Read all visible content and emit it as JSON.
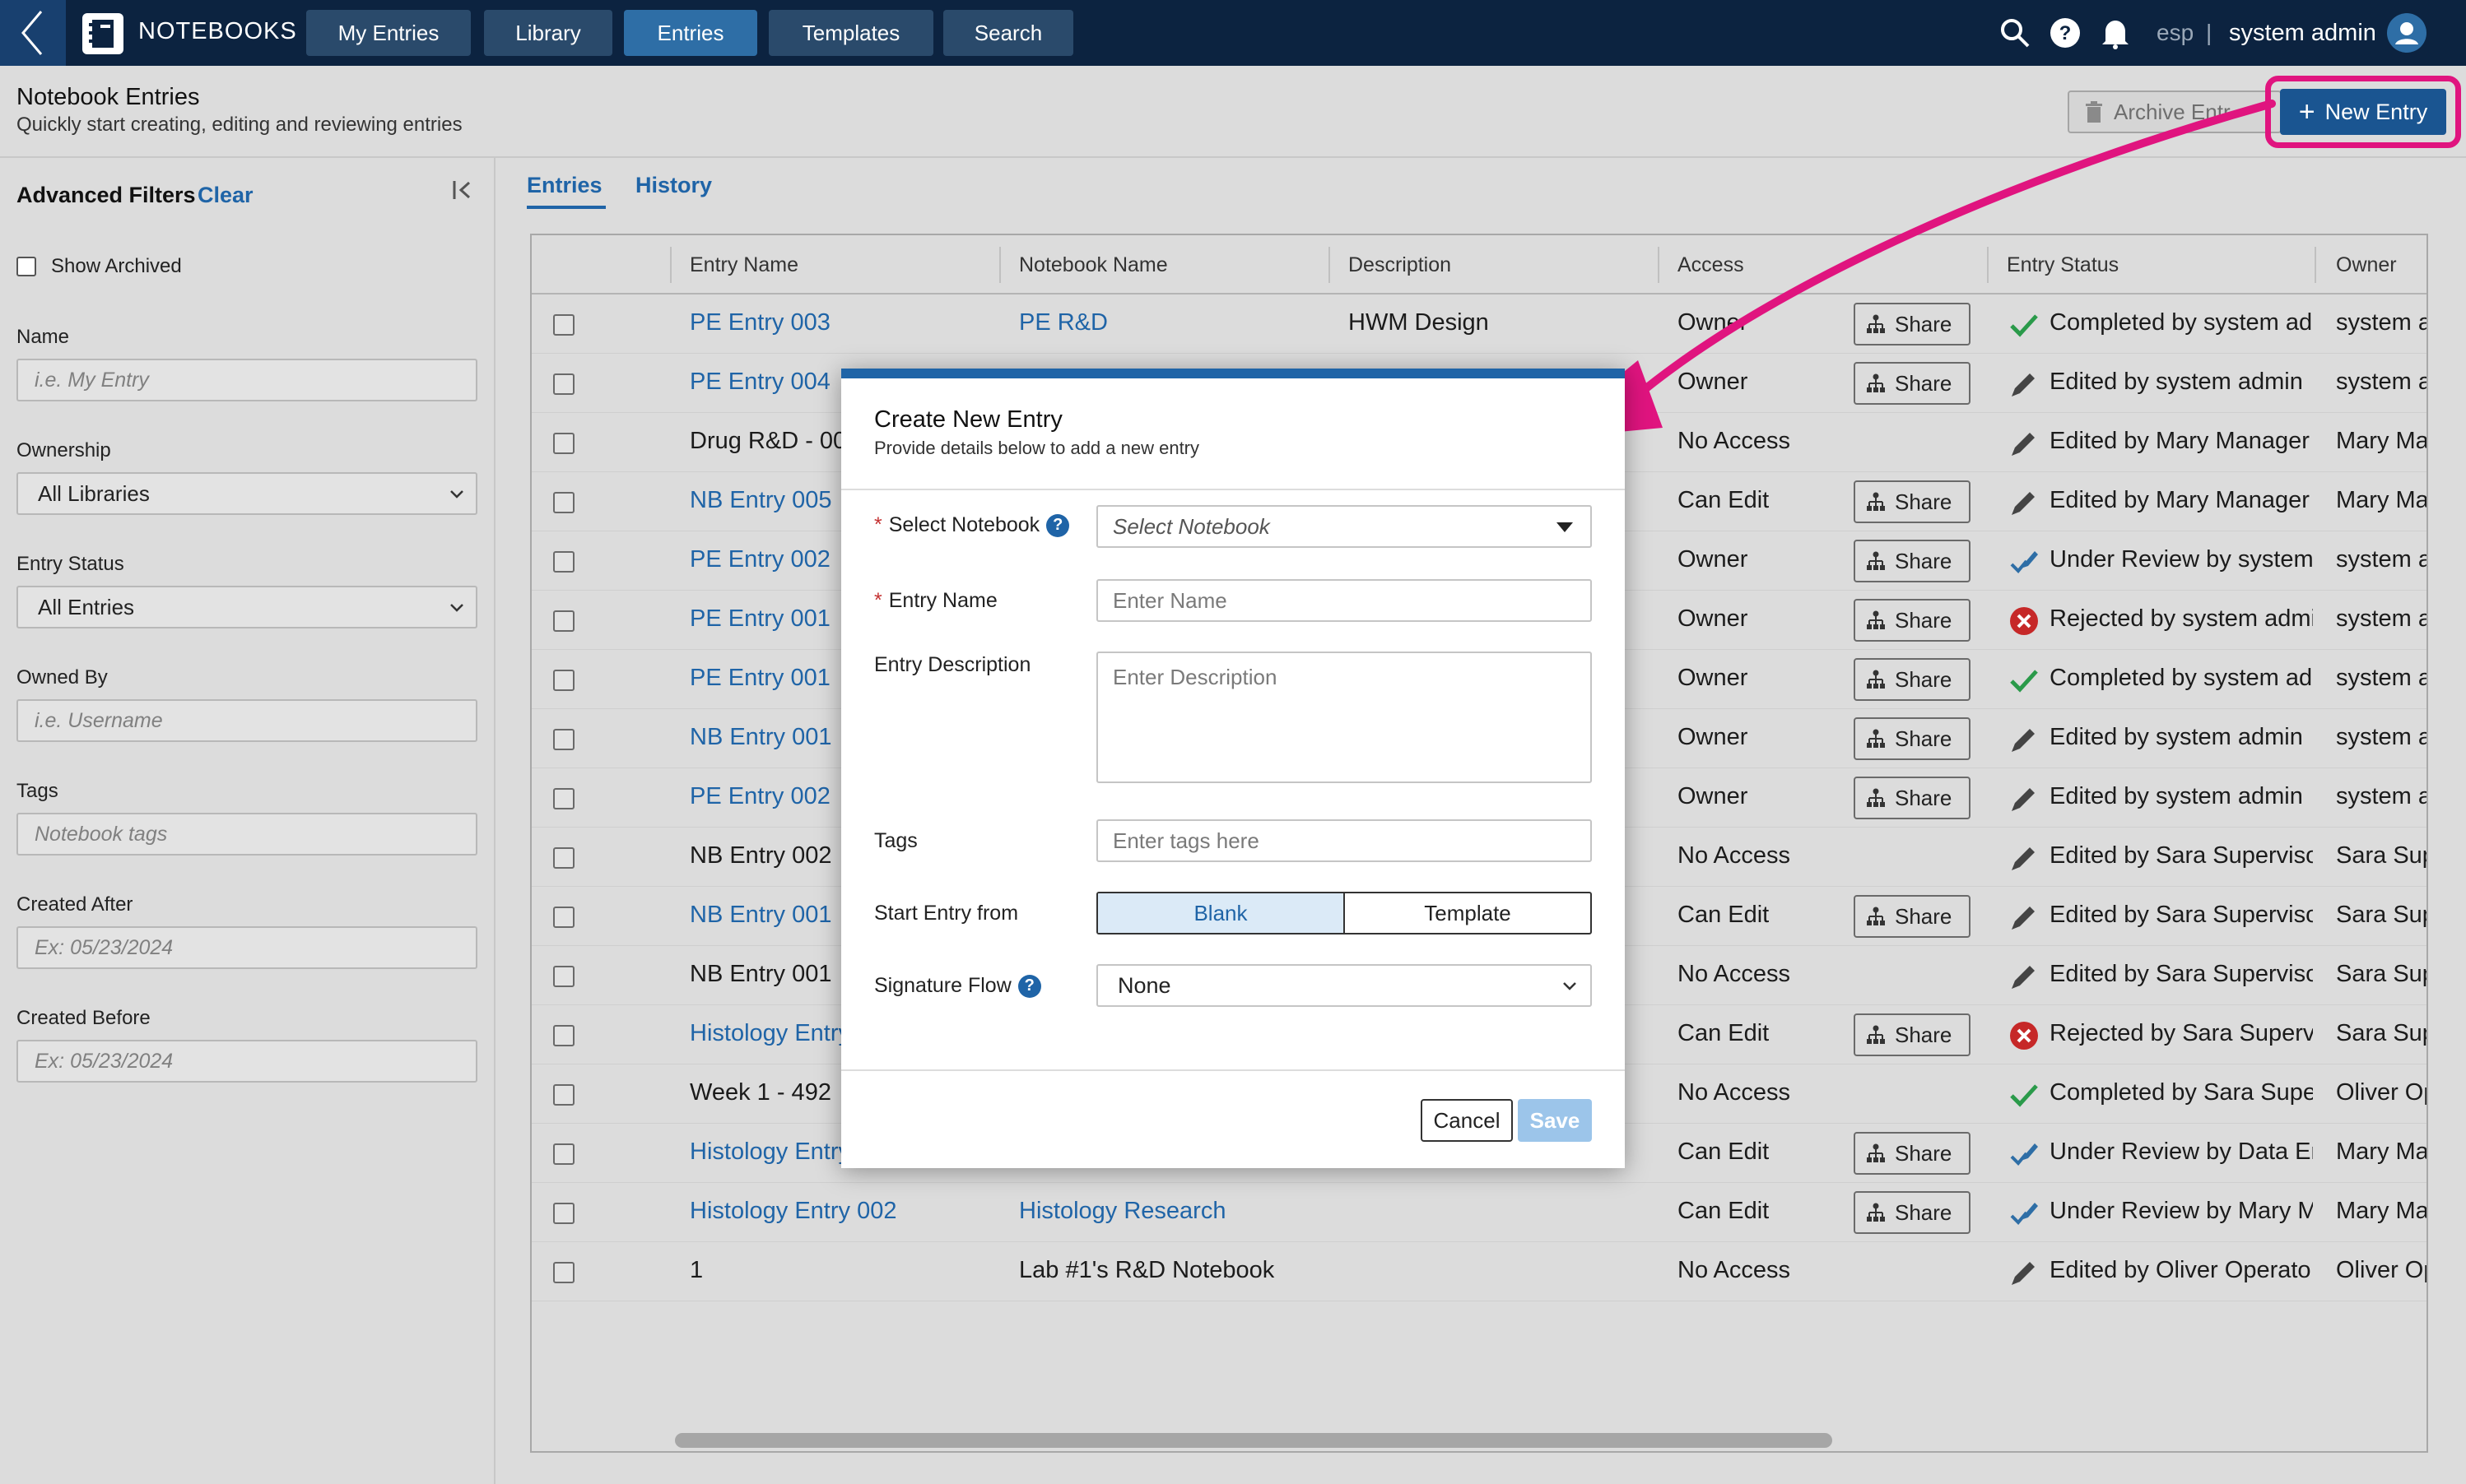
{
  "app": {
    "name": "NOTEBOOKS"
  },
  "nav": {
    "items": [
      {
        "label": "My Entries",
        "active": false
      },
      {
        "label": "Library",
        "active": false
      },
      {
        "label": "Entries",
        "active": true
      },
      {
        "label": "Templates",
        "active": false
      },
      {
        "label": "Search",
        "active": false
      }
    ]
  },
  "topbar": {
    "locale": "esp",
    "separator": "|",
    "user": "system admin"
  },
  "header": {
    "title": "Notebook Entries",
    "subtitle": "Quickly start creating, editing and reviewing entries",
    "archive_label": "Archive Entr",
    "new_entry_label": "New Entry",
    "new_entry_plus": "+"
  },
  "sidebar": {
    "title": "Advanced Filters",
    "clear_label": "Clear",
    "collapse_glyph": "|<",
    "show_archived_label": "Show Archived",
    "name_label": "Name",
    "name_placeholder": "i.e. My Entry",
    "ownership_label": "Ownership",
    "ownership_value": "All Libraries",
    "entry_status_label": "Entry Status",
    "entry_status_value": "All Entries",
    "owned_by_label": "Owned By",
    "owned_by_placeholder": "i.e. Username",
    "tags_label": "Tags",
    "tags_placeholder": "Notebook tags",
    "created_after_label": "Created After",
    "created_after_placeholder": "Ex: 05/23/2024",
    "created_before_label": "Created Before",
    "created_before_placeholder": "Ex: 05/23/2024"
  },
  "tabs": [
    {
      "label": "Entries",
      "active": true
    },
    {
      "label": "History",
      "active": false
    }
  ],
  "table": {
    "columns": [
      "Entry Name",
      "Notebook Name",
      "Description",
      "Access",
      "Entry Status",
      "Owner"
    ],
    "share_label": "Share",
    "rows": [
      {
        "name": "PE Entry 003",
        "name_link": true,
        "notebook": "PE R&D",
        "notebook_link": true,
        "description": "HWM Design",
        "access": "Owner",
        "share": true,
        "status_icon": "check",
        "status": "Completed by system ad",
        "owner": "system a"
      },
      {
        "name": "PE Entry 004",
        "name_link": true,
        "notebook": "",
        "notebook_link": false,
        "description": "",
        "access": "Owner",
        "share": true,
        "status_icon": "pencil",
        "status": "Edited by system admin",
        "owner": "system a"
      },
      {
        "name": "Drug R&D - 00",
        "name_link": false,
        "notebook": "",
        "notebook_link": false,
        "description": "",
        "access": "No Access",
        "share": false,
        "status_icon": "pencil",
        "status": "Edited by Mary Manager",
        "owner": "Mary Ma"
      },
      {
        "name": "NB Entry 005",
        "name_link": true,
        "notebook": "",
        "notebook_link": false,
        "description": "",
        "access": "Can Edit",
        "share": true,
        "status_icon": "pencil",
        "status": "Edited by Mary Manager",
        "owner": "Mary Ma"
      },
      {
        "name": "PE Entry 002",
        "name_link": true,
        "notebook": "",
        "notebook_link": false,
        "description": "",
        "access": "Owner",
        "share": true,
        "status_icon": "review",
        "status": "Under Review by system",
        "owner": "system a"
      },
      {
        "name": "PE Entry 001",
        "name_link": true,
        "notebook": "",
        "notebook_link": false,
        "description": "",
        "access": "Owner",
        "share": true,
        "status_icon": "rejected",
        "status": "Rejected by system admi",
        "owner": "system a"
      },
      {
        "name": "PE Entry 001",
        "name_link": true,
        "notebook": "",
        "notebook_link": false,
        "description": "",
        "access": "Owner",
        "share": true,
        "status_icon": "check",
        "status": "Completed by system ad",
        "owner": "system a"
      },
      {
        "name": "NB Entry 001",
        "name_link": true,
        "notebook": "",
        "notebook_link": false,
        "description": "",
        "access": "Owner",
        "share": true,
        "status_icon": "pencil",
        "status": "Edited by system admin",
        "owner": "system a"
      },
      {
        "name": "PE Entry 002",
        "name_link": true,
        "notebook": "",
        "notebook_link": false,
        "description": "",
        "access": "Owner",
        "share": true,
        "status_icon": "pencil",
        "status": "Edited by system admin",
        "owner": "system a"
      },
      {
        "name": "NB Entry 002",
        "name_link": false,
        "notebook": "",
        "notebook_link": false,
        "description": "",
        "access": "No Access",
        "share": false,
        "status_icon": "pencil",
        "status": "Edited by Sara Superviso",
        "owner": "Sara Sup"
      },
      {
        "name": "NB Entry 001",
        "name_link": true,
        "notebook": "",
        "notebook_link": false,
        "description": "",
        "access": "Can Edit",
        "share": true,
        "status_icon": "pencil",
        "status": "Edited by Sara Superviso",
        "owner": "Sara Sup"
      },
      {
        "name": "NB Entry 001",
        "name_link": false,
        "notebook": "",
        "notebook_link": false,
        "description": "",
        "access": "No Access",
        "share": false,
        "status_icon": "pencil",
        "status": "Edited by Sara Superviso",
        "owner": "Sara Sup"
      },
      {
        "name": "Histology Entry",
        "name_link": true,
        "notebook": "",
        "notebook_link": false,
        "description": "",
        "access": "Can Edit",
        "share": true,
        "status_icon": "rejected",
        "status": "Rejected by Sara Supervis",
        "owner": "Sara Sup"
      },
      {
        "name": "Week 1 - 492",
        "name_link": false,
        "notebook": "",
        "notebook_link": false,
        "description": "",
        "access": "No Access",
        "share": false,
        "status_icon": "check",
        "status": "Completed by Sara Super",
        "owner": "Oliver Op"
      },
      {
        "name": "Histology Entry",
        "name_link": true,
        "notebook": "",
        "notebook_link": false,
        "description": "",
        "access": "Can Edit",
        "share": true,
        "status_icon": "review",
        "status": "Under Review by Data En",
        "owner": "Mary Ma"
      },
      {
        "name": "Histology Entry 002",
        "name_link": true,
        "notebook": "Histology Research",
        "notebook_link": true,
        "description": "",
        "access": "Can Edit",
        "share": true,
        "status_icon": "review",
        "status": "Under Review by Mary M",
        "owner": "Mary Ma"
      },
      {
        "name": "1",
        "name_link": false,
        "notebook": "Lab #1's R&D Notebook",
        "notebook_link": false,
        "description": "",
        "access": "No Access",
        "share": false,
        "status_icon": "pencil",
        "status": "Edited by Oliver Operato",
        "owner": "Oliver Op"
      }
    ]
  },
  "modal": {
    "title": "Create New Entry",
    "subtitle": "Provide details below to add a new entry",
    "required_mark": "*",
    "select_notebook_label": "Select Notebook",
    "select_notebook_placeholder": "Select Notebook",
    "entry_name_label": "Entry Name",
    "entry_name_placeholder": "Enter Name",
    "entry_description_label": "Entry Description",
    "entry_description_placeholder": "Enter Description",
    "tags_label": "Tags",
    "tags_placeholder": "Enter tags here",
    "start_from_label": "Start Entry from",
    "start_options": [
      {
        "label": "Blank",
        "selected": true
      },
      {
        "label": "Template",
        "selected": false
      }
    ],
    "signature_flow_label": "Signature Flow",
    "signature_flow_value": "None",
    "help_glyph": "?",
    "cancel_label": "Cancel",
    "save_label": "Save"
  },
  "colors": {
    "nav_bg": "#0c2340",
    "accent": "#1f64a7",
    "annotation": "#e0147f",
    "success": "#2a9a4a",
    "danger": "#c62828"
  }
}
